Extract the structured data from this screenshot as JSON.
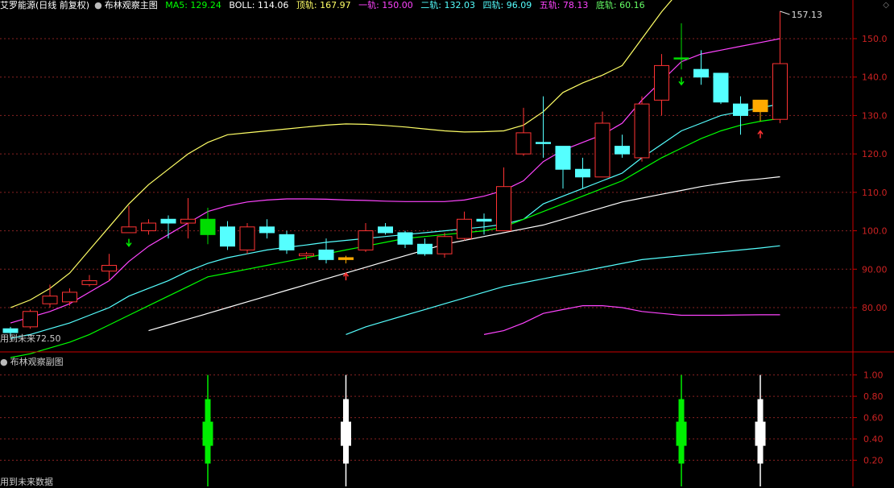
{
  "header": {
    "indicator_name": "艾罗能源(日线 前复权)",
    "main_chart_name": "布林观察主图",
    "ma5": "MA5: 129.24",
    "boll": "BOLL: 114.06",
    "top_band": "顶轨: 167.97",
    "band1": "一轨: 150.00",
    "band2": "二轨: 132.03",
    "band4": "四轨: 96.09",
    "band5": "五轨: 78.13",
    "bottom_band": "底轨: 60.16"
  },
  "colors": {
    "ma5": "#00ff00",
    "boll": "#ffffff",
    "top_band": "#ffff66",
    "band1": "#ff44ff",
    "band2": "#55ffff",
    "band4": "#55ffff",
    "band5": "#ff44ff",
    "bottom_band": "#66ff66",
    "up_candle": "#ff3333",
    "down_candle": "#55ffff",
    "flat_candle": "#ffaa00",
    "axis": "#cc0000"
  },
  "main_pane": {
    "last_high_label": "157.13",
    "future_note": "用到未来72.50",
    "y_ticks": [
      "150.0",
      "140.0",
      "130.0",
      "120.0",
      "110.0",
      "100.0",
      "90.00",
      "80.00"
    ]
  },
  "sub_pane": {
    "title": "布林观察副图",
    "future_note": "用到未来数据",
    "y_ticks": [
      "1.00",
      "0.80",
      "0.60",
      "0.40",
      "0.20"
    ]
  },
  "chart_data": {
    "type": "candlestick",
    "title": "布林观察主图",
    "ylim": [
      70,
      160
    ],
    "candles": [
      {
        "o": 73.5,
        "h": 75.0,
        "l": 72.5,
        "c": 74.5
      },
      {
        "o": 75.0,
        "h": 79.5,
        "l": 74.5,
        "c": 79.0
      },
      {
        "o": 81.0,
        "h": 86.0,
        "l": 80.0,
        "c": 83.0
      },
      {
        "o": 81.5,
        "h": 85.0,
        "l": 80.5,
        "c": 84.0
      },
      {
        "o": 86.0,
        "h": 88.5,
        "l": 85.5,
        "c": 87.0
      },
      {
        "o": 89.5,
        "h": 94.0,
        "l": 87.0,
        "c": 91.0
      },
      {
        "o": 101.0,
        "h": 106.5,
        "l": 100.0,
        "c": 99.5
      },
      {
        "o": 100.0,
        "h": 103.0,
        "l": 99.0,
        "c": 102.0
      },
      {
        "o": 103.0,
        "h": 104.0,
        "l": 98.0,
        "c": 102.0
      },
      {
        "o": 102.0,
        "h": 108.5,
        "l": 98.0,
        "c": 103.0
      },
      {
        "o": 103.0,
        "h": 106.0,
        "l": 96.5,
        "c": 99.0
      },
      {
        "o": 101.0,
        "h": 102.5,
        "l": 95.0,
        "c": 96.0
      },
      {
        "o": 95.0,
        "h": 102.0,
        "l": 94.0,
        "c": 101.0
      },
      {
        "o": 101.0,
        "h": 103.0,
        "l": 98.0,
        "c": 99.5
      },
      {
        "o": 99.0,
        "h": 100.0,
        "l": 94.0,
        "c": 95.0
      },
      {
        "o": 93.5,
        "h": 94.5,
        "l": 92.5,
        "c": 94.0
      },
      {
        "o": 95.0,
        "h": 98.0,
        "l": 91.5,
        "c": 92.5
      },
      {
        "o": 92.5,
        "h": 93.5,
        "l": 91.5,
        "c": 93.0
      },
      {
        "o": 95.0,
        "h": 102.0,
        "l": 94.5,
        "c": 100.0
      },
      {
        "o": 101.0,
        "h": 102.0,
        "l": 99.0,
        "c": 99.5
      },
      {
        "o": 99.5,
        "h": 100.0,
        "l": 95.5,
        "c": 96.5
      },
      {
        "o": 96.5,
        "h": 98.0,
        "l": 93.5,
        "c": 94.0
      },
      {
        "o": 94.0,
        "h": 99.5,
        "l": 93.0,
        "c": 98.5
      },
      {
        "o": 98.0,
        "h": 105.0,
        "l": 97.5,
        "c": 103.0
      },
      {
        "o": 103.0,
        "h": 104.5,
        "l": 99.0,
        "c": 102.5
      },
      {
        "o": 100.0,
        "h": 116.5,
        "l": 100.0,
        "c": 111.5
      },
      {
        "o": 120.0,
        "h": 132.0,
        "l": 119.5,
        "c": 125.5
      },
      {
        "o": 123.0,
        "h": 135.0,
        "l": 119.0,
        "c": 123.0
      },
      {
        "o": 122.0,
        "h": 122.0,
        "l": 111.0,
        "c": 116.0
      },
      {
        "o": 116.0,
        "h": 119.0,
        "l": 111.0,
        "c": 114.0
      },
      {
        "o": 114.0,
        "h": 131.0,
        "l": 114.0,
        "c": 128.0
      },
      {
        "o": 122.0,
        "h": 125.0,
        "l": 119.0,
        "c": 120.0
      },
      {
        "o": 119.0,
        "h": 135.0,
        "l": 118.0,
        "c": 133.0
      },
      {
        "o": 134.0,
        "h": 146.0,
        "l": 130.0,
        "c": 143.0
      },
      {
        "o": 145.0,
        "h": 154.0,
        "l": 142.0,
        "c": 145.0
      },
      {
        "o": 142.0,
        "h": 147.0,
        "l": 138.0,
        "c": 140.0
      },
      {
        "o": 141.0,
        "h": 141.0,
        "l": 133.0,
        "c": 133.5
      },
      {
        "o": 133.0,
        "h": 135.0,
        "l": 125.0,
        "c": 130.0
      },
      {
        "o": 131.0,
        "h": 134.0,
        "l": 128.5,
        "c": 134.0
      },
      {
        "o": 129.0,
        "h": 157.13,
        "l": 128.0,
        "c": 143.5
      }
    ],
    "candle_colors": [
      "cyan",
      "red",
      "red",
      "red",
      "red",
      "red",
      "red",
      "red",
      "cyan",
      "red",
      "green",
      "cyan",
      "red",
      "cyan",
      "cyan",
      "red",
      "cyan",
      "orange",
      "red",
      "cyan",
      "cyan",
      "cyan",
      "red",
      "red",
      "cyan",
      "red",
      "red",
      "cyan",
      "cyan",
      "cyan",
      "red",
      "cyan",
      "red",
      "red",
      "green",
      "cyan",
      "cyan",
      "cyan",
      "orange",
      "red"
    ],
    "series": [
      {
        "key": "top_band",
        "values": [
          80,
          82,
          85,
          89,
          95,
          101,
          107,
          112,
          116,
          120,
          123,
          125,
          125.5,
          126,
          126.5,
          127,
          127.5,
          127.8,
          127.7,
          127.4,
          127,
          126.5,
          126,
          125.7,
          125.8,
          126,
          127.5,
          131,
          136,
          138.5,
          140.5,
          143,
          150,
          157,
          163,
          168,
          171,
          171,
          171,
          171
        ]
      },
      {
        "key": "band1",
        "values": [
          76,
          77.5,
          79,
          81,
          84,
          87,
          92,
          96,
          99,
          102,
          105,
          106.5,
          107.5,
          108,
          108.3,
          108.3,
          108.2,
          108,
          107.9,
          107.7,
          107.6,
          107.6,
          107.6,
          108,
          109,
          110.5,
          113,
          118,
          121,
          123,
          125,
          128,
          134,
          139,
          144,
          146,
          147,
          148,
          149,
          150
        ]
      },
      {
        "key": "band2",
        "values": [
          72,
          73,
          74.5,
          76,
          78,
          80,
          83,
          85,
          87,
          89.5,
          91.5,
          93,
          94,
          95,
          95.7,
          96.3,
          97,
          97.5,
          98,
          98.5,
          99,
          99.5,
          100,
          100.5,
          101,
          101.7,
          103,
          107,
          109,
          111,
          113,
          115,
          119,
          122.5,
          126,
          128,
          130,
          131,
          132,
          133
        ]
      },
      {
        "key": "ma5",
        "values": [
          67,
          68,
          69.5,
          71,
          73,
          75.5,
          78,
          80.5,
          83,
          85.5,
          88,
          89,
          90,
          91,
          92,
          93,
          94,
          95,
          96,
          97,
          98,
          98.5,
          99,
          99.5,
          100,
          101,
          103,
          105,
          107,
          109,
          111,
          113,
          116,
          119,
          121.5,
          124,
          126,
          127.5,
          128.5,
          129.24
        ]
      },
      {
        "key": "boll",
        "values": [
          null,
          null,
          null,
          null,
          null,
          null,
          null,
          74,
          75.5,
          77,
          78.5,
          80,
          81.5,
          83,
          84.5,
          86,
          87.5,
          89,
          90.5,
          92,
          93.5,
          95,
          96.5,
          97.5,
          98.5,
          99.5,
          100.5,
          101.5,
          103,
          104.5,
          106,
          107.5,
          108.5,
          109.5,
          110.5,
          111.5,
          112.3,
          113,
          113.5,
          114.06
        ]
      },
      {
        "key": "band4",
        "values": [
          null,
          null,
          null,
          null,
          null,
          null,
          null,
          null,
          null,
          null,
          null,
          null,
          null,
          null,
          null,
          null,
          null,
          73,
          75,
          76.5,
          78,
          79.5,
          81,
          82.5,
          84,
          85.5,
          86.5,
          87.5,
          88.5,
          89.5,
          90.5,
          91.5,
          92.5,
          93,
          93.5,
          94,
          94.5,
          95,
          95.5,
          96.09
        ]
      },
      {
        "key": "band5",
        "values": [
          null,
          null,
          null,
          null,
          null,
          null,
          null,
          null,
          null,
          null,
          null,
          null,
          null,
          null,
          null,
          null,
          null,
          null,
          null,
          null,
          null,
          null,
          null,
          null,
          73,
          74,
          76,
          78.5,
          79.5,
          80.5,
          80.5,
          80,
          79,
          78.5,
          78,
          78,
          78,
          78.1,
          78.13,
          78.13
        ]
      }
    ],
    "signals_down": [
      6,
      34
    ],
    "signals_up": [
      17,
      38
    ],
    "sub_bars": [
      {
        "index": 10,
        "color": "green",
        "height": 1.0
      },
      {
        "index": 17,
        "color": "white",
        "height": 1.0
      },
      {
        "index": 34,
        "color": "green",
        "height": 1.0
      },
      {
        "index": 38,
        "color": "white",
        "height": 1.0
      }
    ],
    "sub_ylim": [
      0,
      1.05
    ]
  }
}
